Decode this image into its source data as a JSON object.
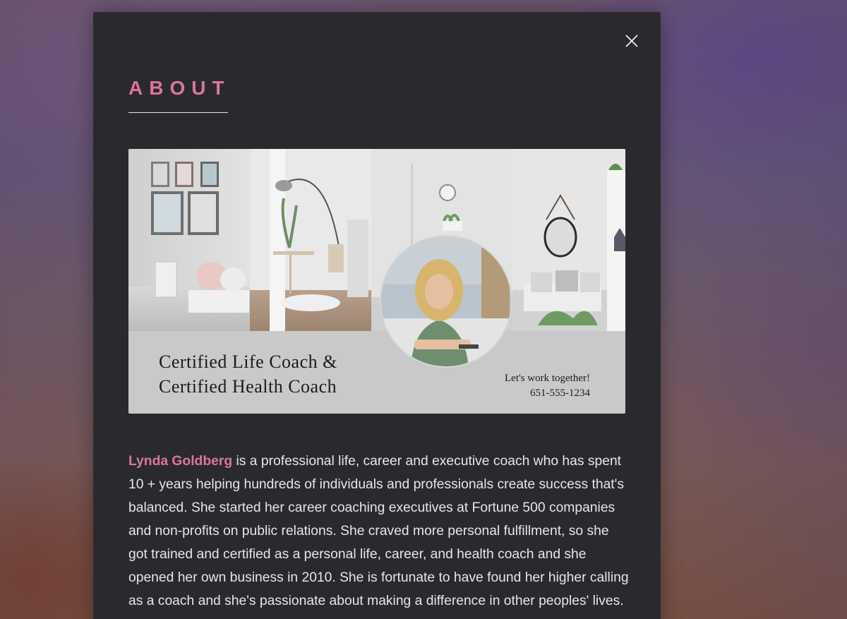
{
  "about": {
    "heading": "ABOUT",
    "close_icon": "close-icon"
  },
  "banner": {
    "headline_line1": "Certified Life Coach &",
    "headline_line2": "Certified Health Coach",
    "cta_line1": "Let's work together!",
    "cta_line2": "651-555-1234"
  },
  "bio": {
    "name": "Lynda Goldberg",
    "text": " is a professional life, career and executive coach who has spent 10 + years helping hundreds of individuals and professionals create success that's balanced. She started her career coaching executives at Fortune 500 companies and non-profits on public relations. She craved more personal fulfillment, so she got trained and certified as a personal life, career, and health coach and she opened her own business in 2010. She is fortunate to have found her higher calling as a coach and she's passionate about making a difference in other peoples' lives."
  },
  "colors": {
    "accent": "#d9769c",
    "modal_background": "#2a2a2e",
    "body_text": "#e6e6e6"
  }
}
